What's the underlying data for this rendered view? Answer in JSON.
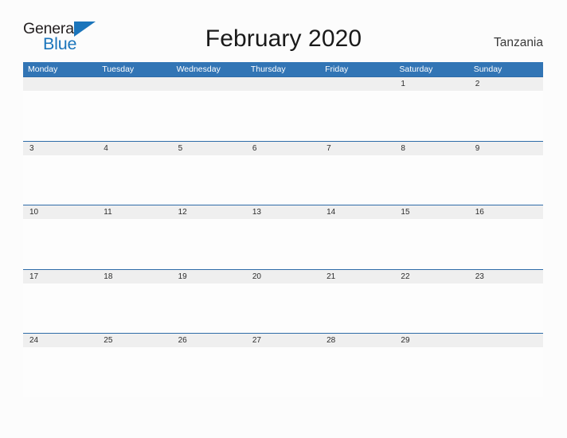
{
  "brand": {
    "name_part1": "General",
    "name_part2": "Blue",
    "triangle_color": "#1b75bb",
    "text_color": "#231f20"
  },
  "header": {
    "title": "February 2020",
    "region": "Tanzania"
  },
  "calendar": {
    "month": "February",
    "year": "2020",
    "header_color": "#3275b5",
    "date_band_color": "#efefef",
    "row_divider_color": "#2e6ca8",
    "weekday_headers": [
      "Monday",
      "Tuesday",
      "Wednesday",
      "Thursday",
      "Friday",
      "Saturday",
      "Sunday"
    ],
    "weeks": [
      {
        "days": [
          "",
          "",
          "",
          "",
          "",
          "1",
          "2"
        ]
      },
      {
        "days": [
          "3",
          "4",
          "5",
          "6",
          "7",
          "8",
          "9"
        ]
      },
      {
        "days": [
          "10",
          "11",
          "12",
          "13",
          "14",
          "15",
          "16"
        ]
      },
      {
        "days": [
          "17",
          "18",
          "19",
          "20",
          "21",
          "22",
          "23"
        ]
      },
      {
        "days": [
          "24",
          "25",
          "26",
          "27",
          "28",
          "29",
          ""
        ]
      }
    ]
  }
}
